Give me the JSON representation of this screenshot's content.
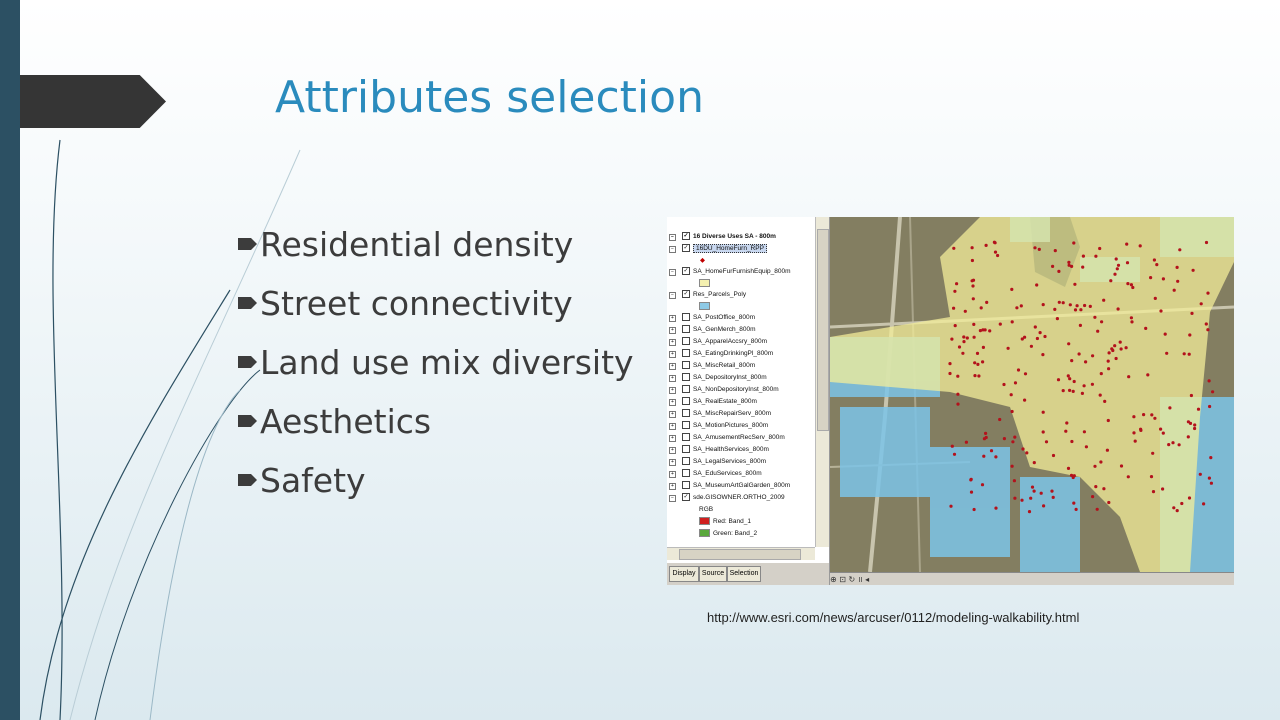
{
  "slide": {
    "title": "Attributes selection",
    "bullets": [
      "Residential density",
      "Street connectivity",
      "Land use mix diversity",
      "Aesthetics",
      "Safety"
    ],
    "source_url": "http://www.esri.com/news/arcuser/0112/modeling-walkability.html"
  },
  "colors": {
    "accent": "#2a8bbd",
    "strip": "#2c5063",
    "tab": "#353535",
    "text": "#3c3c3c"
  },
  "gis": {
    "toc_rows": [
      {
        "kind": "group",
        "label": "16 Diverse Uses SA - 800m",
        "exp": "⊟",
        "checked": true
      },
      {
        "kind": "layer",
        "label": "16DU_HomeFurn_RPP",
        "exp": "⊟",
        "checked": true,
        "highlight": true
      },
      {
        "kind": "sym",
        "label": "◆",
        "color": "#c00000"
      },
      {
        "kind": "layer",
        "label": "SA_HomeFurFurnishEquip_800m",
        "exp": "⊟",
        "checked": true
      },
      {
        "kind": "sym",
        "swatch": "#f4f0b0"
      },
      {
        "kind": "layer",
        "label": "Res_Parcels_Poly",
        "exp": "⊟",
        "checked": true
      },
      {
        "kind": "sym",
        "swatch": "#8ecae6"
      },
      {
        "kind": "layer",
        "label": "SA_PostOffice_800m",
        "exp": "⊞",
        "checked": false
      },
      {
        "kind": "layer",
        "label": "SA_GenMerch_800m",
        "exp": "⊞",
        "checked": false
      },
      {
        "kind": "layer",
        "label": "SA_ApparelAccsry_800m",
        "exp": "⊞",
        "checked": false
      },
      {
        "kind": "layer",
        "label": "SA_EatingDrinkingPl_800m",
        "exp": "⊞",
        "checked": false
      },
      {
        "kind": "layer",
        "label": "SA_MiscRetail_800m",
        "exp": "⊞",
        "checked": false
      },
      {
        "kind": "layer",
        "label": "SA_DepositoryInst_800m",
        "exp": "⊞",
        "checked": false
      },
      {
        "kind": "layer",
        "label": "SA_NonDepositoryInst_800m",
        "exp": "⊞",
        "checked": false
      },
      {
        "kind": "layer",
        "label": "SA_RealEstate_800m",
        "exp": "⊞",
        "checked": false
      },
      {
        "kind": "layer",
        "label": "SA_MiscRepairServ_800m",
        "exp": "⊞",
        "checked": false
      },
      {
        "kind": "layer",
        "label": "SA_MotionPictures_800m",
        "exp": "⊞",
        "checked": false
      },
      {
        "kind": "layer",
        "label": "SA_AmusementRecServ_800m",
        "exp": "⊞",
        "checked": false
      },
      {
        "kind": "layer",
        "label": "SA_HealthServices_800m",
        "exp": "⊞",
        "checked": false
      },
      {
        "kind": "layer",
        "label": "SA_LegalServices_800m",
        "exp": "⊞",
        "checked": false
      },
      {
        "kind": "layer",
        "label": "SA_EduServices_800m",
        "exp": "⊞",
        "checked": false
      },
      {
        "kind": "layer",
        "label": "SA_MuseumArtGalGarden_800m",
        "exp": "⊞",
        "checked": false
      },
      {
        "kind": "layer",
        "label": "sde.GISOWNER.ORTHO_2009",
        "exp": "⊟",
        "checked": true
      },
      {
        "kind": "text",
        "label": "RGB"
      },
      {
        "kind": "band",
        "label": "Red:   Band_1",
        "swatch": "#d02020"
      },
      {
        "kind": "band",
        "label": "Green: Band_2",
        "swatch": "#5aa83c"
      }
    ],
    "tabs": [
      "Display",
      "Source",
      "Selection"
    ],
    "map_bar": "⊕ ⊡ ↻ ॥ ◂"
  }
}
